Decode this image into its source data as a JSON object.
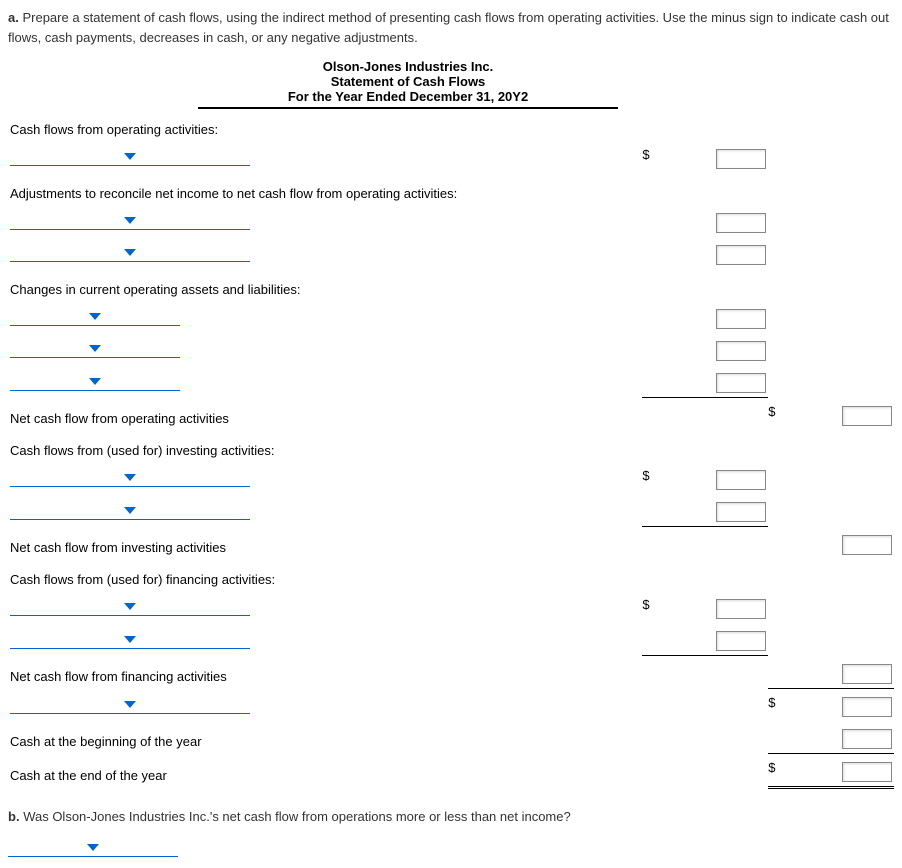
{
  "partA": {
    "label": "a.",
    "prompt": "Prepare a statement of cash flows, using the indirect method of presenting cash flows from operating activities. Use the minus sign to indicate cash out flows, cash payments, decreases in cash, or any negative adjustments."
  },
  "headings": {
    "company": "Olson-Jones Industries Inc.",
    "title": "Statement of Cash Flows",
    "period": "For the Year Ended December 31, 20Y2"
  },
  "rows": {
    "opHeader": "Cash flows from operating activities:",
    "adj": "Adjustments to reconcile net income to net cash flow from operating activities:",
    "changes": "Changes in current operating assets and liabilities:",
    "netOp": "Net cash flow from operating activities",
    "invHeader": "Cash flows from (used for) investing activities:",
    "netInv": "Net cash flow from investing activities",
    "finHeader": "Cash flows from (used for) financing activities:",
    "netFin": "Net cash flow from financing activities",
    "cashBeg": "Cash at the beginning of the year",
    "cashEnd": "Cash at the end of the year"
  },
  "partB": {
    "label": "b.",
    "question": "Was Olson-Jones Industries Inc.'s net cash flow from operations more or less than net income?"
  },
  "symbols": {
    "dollar": "$"
  }
}
